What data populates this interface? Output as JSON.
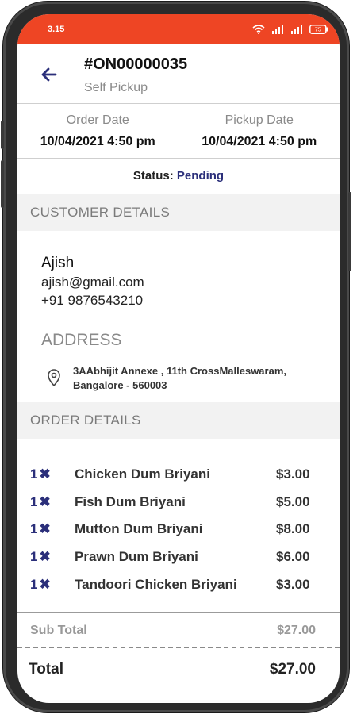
{
  "status_bar": {
    "time": "3.15",
    "battery": "75"
  },
  "header": {
    "order_number": "#ON00000035",
    "order_type": "Self Pickup"
  },
  "dates": {
    "order_label": "Order Date",
    "order_value": "10/04/2021 4:50 pm",
    "pickup_label": "Pickup Date",
    "pickup_value": "10/04/2021 4:50 pm"
  },
  "status": {
    "label": "Status:",
    "value": "Pending"
  },
  "customer": {
    "section_title": "CUSTOMER DETAILS",
    "name": "Ajish",
    "email": "ajish@gmail.com",
    "phone": "+91 9876543210",
    "address_title": "ADDRESS",
    "address_line1": "3AAbhijit Annexe , 11th CrossMalleswaram,",
    "address_line2": "Bangalore - 560003"
  },
  "order": {
    "section_title": "ORDER DETAILS",
    "items": [
      {
        "qty": "1",
        "name": "Chicken Dum Briyani",
        "price": "$3.00"
      },
      {
        "qty": "1",
        "name": "Fish Dum Briyani",
        "price": "$5.00"
      },
      {
        "qty": "1",
        "name": "Mutton Dum Briyani",
        "price": "$8.00"
      },
      {
        "qty": "1",
        "name": "Prawn Dum Briyani",
        "price": "$6.00"
      },
      {
        "qty": "1",
        "name": "Tandoori Chicken Briyani",
        "price": "$3.00"
      }
    ],
    "subtotal_label": "Sub Total",
    "subtotal_value": "$27.00",
    "total_label": "Total",
    "total_value": "$27.00"
  },
  "colors": {
    "accent": "#ee4524",
    "primary": "#2b2f7a"
  },
  "icons": {
    "back": "arrow-left-icon",
    "location": "map-pin-icon",
    "multiply": "x-icon"
  }
}
